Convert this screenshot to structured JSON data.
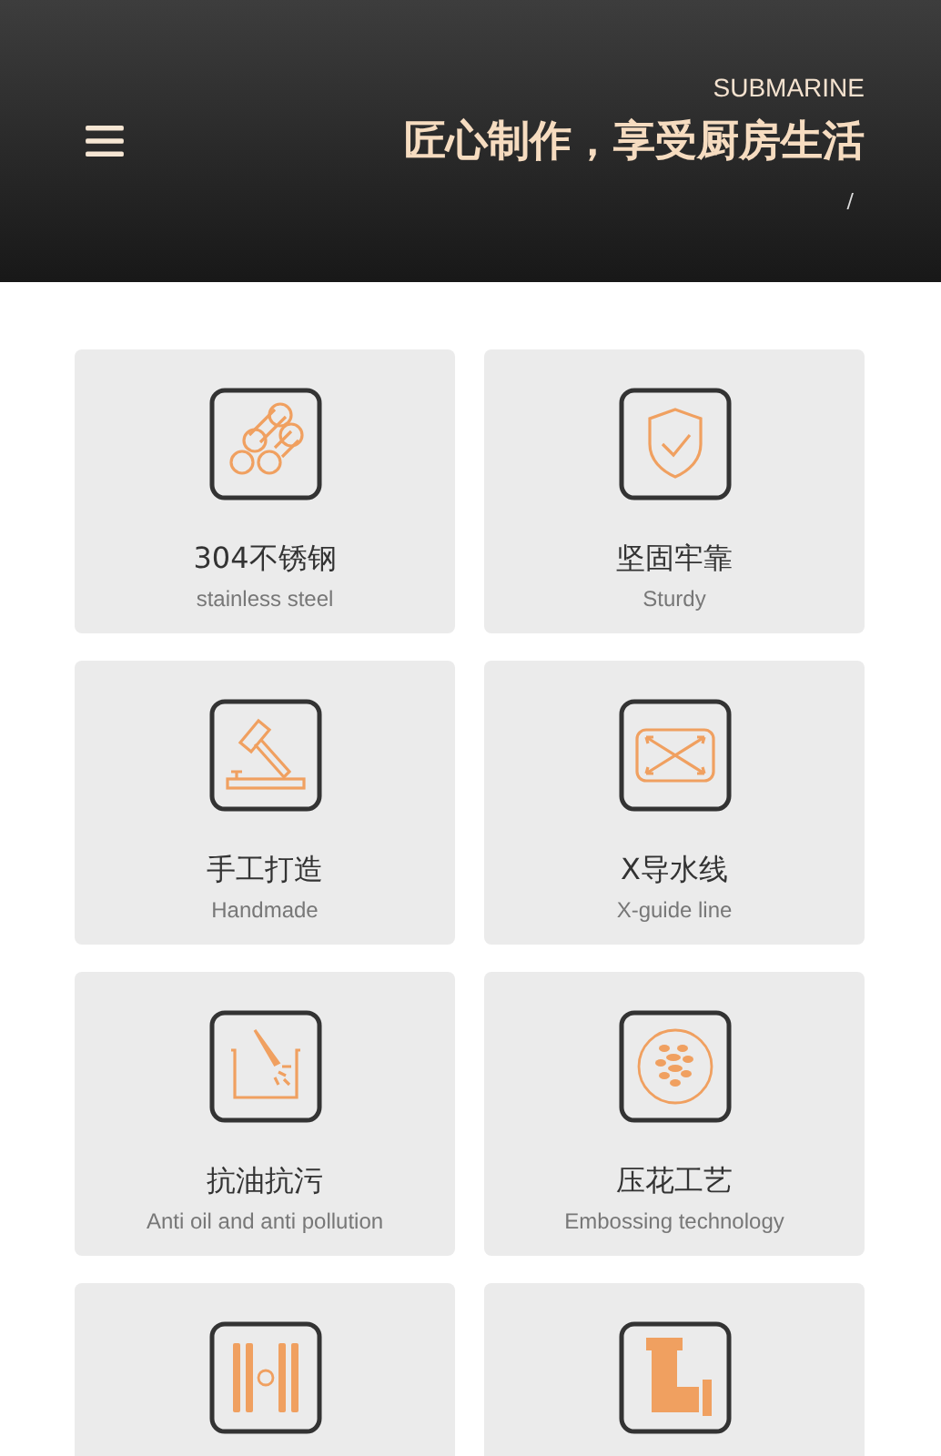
{
  "header": {
    "brand": "SUBMARINE",
    "slogan": "匠心制作，享受厨房生活",
    "separator": "/"
  },
  "features": [
    {
      "kind": "pipes",
      "title": "304不锈钢",
      "subtitle": "stainless steel"
    },
    {
      "kind": "shield",
      "title": "坚固牢靠",
      "subtitle": "Sturdy"
    },
    {
      "kind": "hammer",
      "title": "手工打造",
      "subtitle": "Handmade"
    },
    {
      "kind": "cross",
      "title": "X导水线",
      "subtitle": "X-guide line"
    },
    {
      "kind": "spray",
      "title": "抗油抗污",
      "subtitle": "Anti oil and anti pollution"
    },
    {
      "kind": "emboss",
      "title": "压花工艺",
      "subtitle": "Embossing technology"
    },
    {
      "kind": "bars"
    },
    {
      "kind": "elbow"
    }
  ]
}
